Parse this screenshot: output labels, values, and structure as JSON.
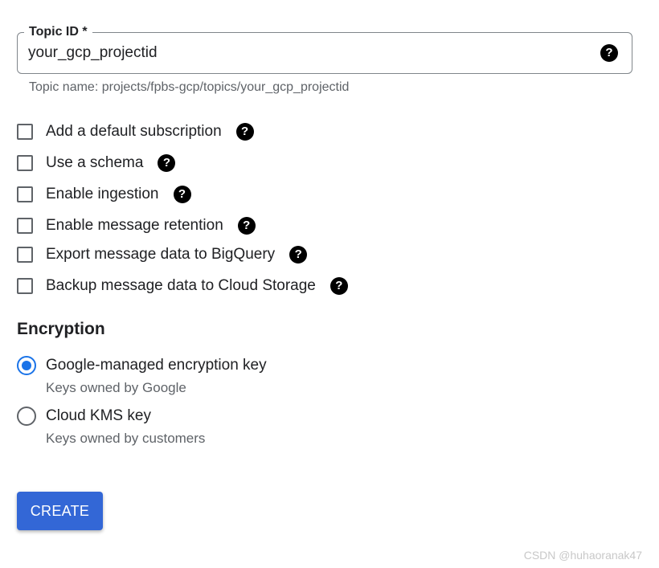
{
  "topic_field": {
    "label": "Topic ID *",
    "value": "your_gcp_projectid",
    "help_icon": "help-icon",
    "hint": "Topic name: projects/fpbs-gcp/topics/your_gcp_projectid"
  },
  "options": [
    {
      "label": "Add a default subscription",
      "checked": false
    },
    {
      "label": "Use a schema",
      "checked": false
    },
    {
      "label": "Enable ingestion",
      "checked": false
    },
    {
      "label": "Enable message retention",
      "checked": false
    },
    {
      "label": "Export message data to BigQuery",
      "checked": false
    },
    {
      "label": "Backup message data to Cloud Storage",
      "checked": false
    }
  ],
  "help_glyph": "?",
  "encryption": {
    "title": "Encryption",
    "choices": [
      {
        "label": "Google-managed encryption key",
        "sublabel": "Keys owned by Google",
        "selected": true
      },
      {
        "label": "Cloud KMS key",
        "sublabel": "Keys owned by customers",
        "selected": false
      }
    ]
  },
  "create_button": {
    "label": "CREATE"
  },
  "watermark": "CSDN @huhaoranak47",
  "colors": {
    "accent": "#1a73e8",
    "button": "#3367d6",
    "text": "#202124",
    "secondary_text": "#5f6368"
  }
}
